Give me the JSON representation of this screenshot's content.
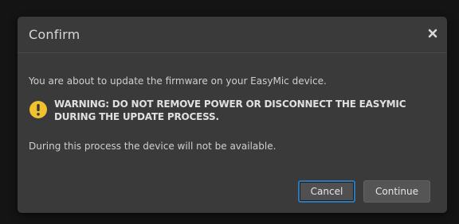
{
  "dialog": {
    "title": "Confirm",
    "close_icon": "close-icon",
    "intro": "You are about to update the firmware on your EasyMic device.",
    "warning_icon": "warning-icon",
    "warning_line1": "WARNING: DO NOT REMOVE POWER OR DISCONNECT THE EASYMIC",
    "warning_line2": "DURING THE UPDATE PROCESS.",
    "note": "During this process the device will not be available.",
    "cancel_label": "Cancel",
    "continue_label": "Continue"
  },
  "colors": {
    "modal_bg": "#3a3a3a",
    "backdrop": "#141414",
    "focus_ring": "#2d79b8",
    "warning_yellow": "#f2c12e"
  }
}
